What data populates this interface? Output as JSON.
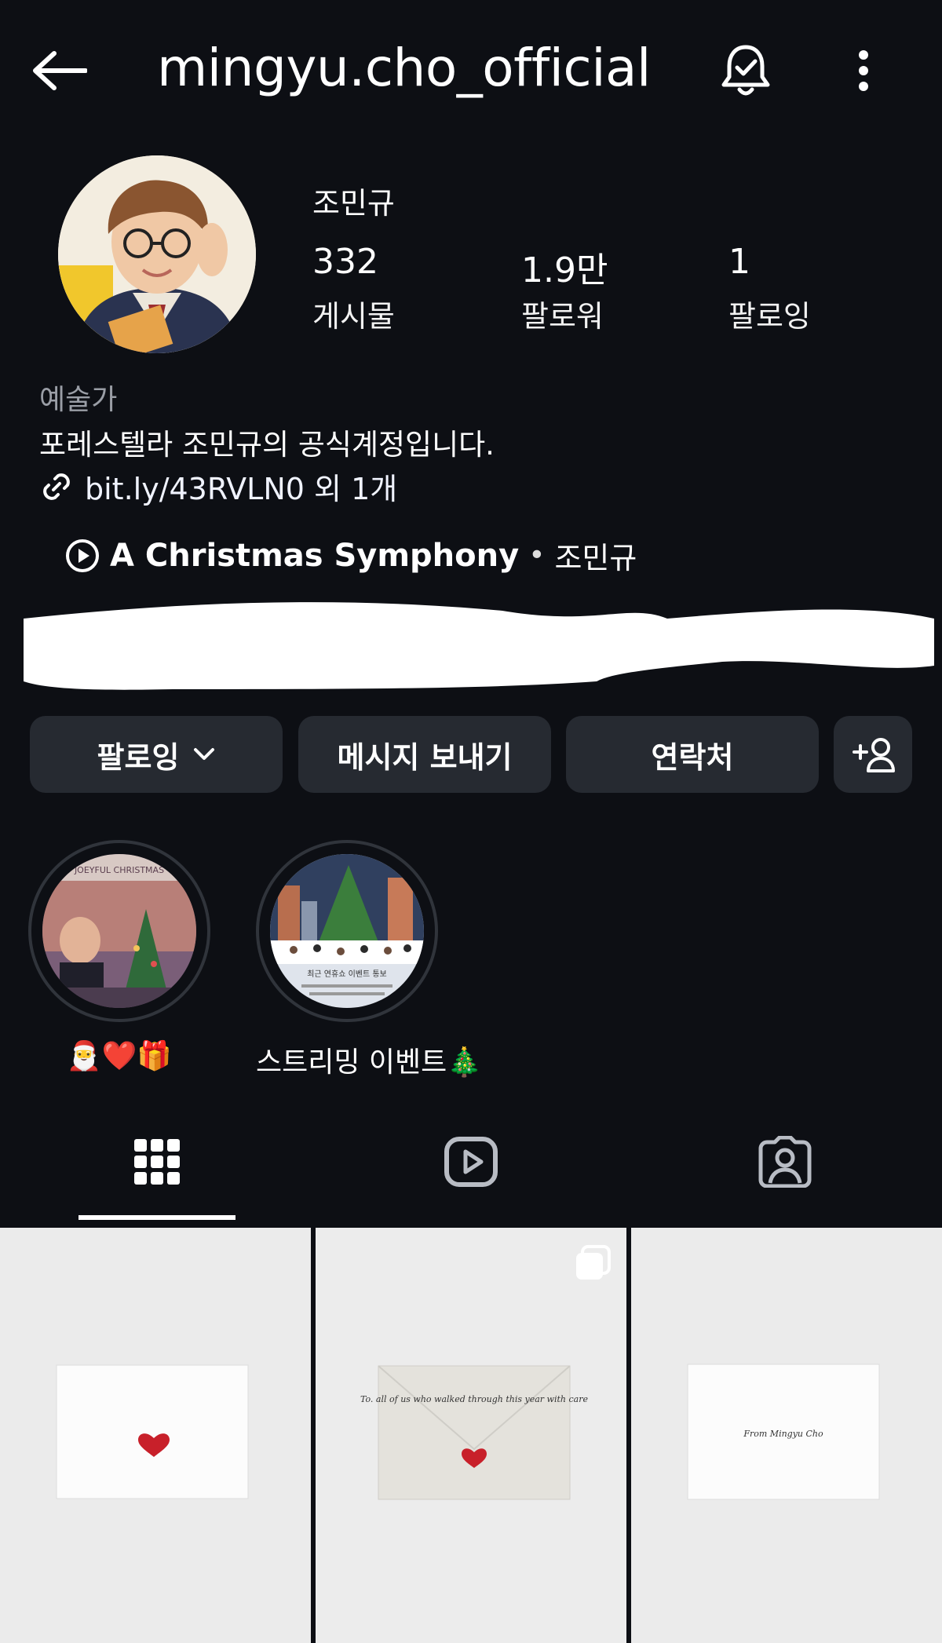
{
  "header": {
    "username": "mingyu.cho_official"
  },
  "profile": {
    "display_name": "조민규",
    "stats": [
      {
        "value": "332",
        "label": "게시물"
      },
      {
        "value": "1.9만",
        "label": "팔로워"
      },
      {
        "value": "1",
        "label": "팔로잉"
      }
    ],
    "category": "예술가",
    "bio": "포레스텔라 조민규의 공식계정입니다.",
    "link": "bit.ly/43RVLN0 외 1개",
    "music": {
      "title": "A Christmas Symphony",
      "separator": "•",
      "artist": "조민규"
    }
  },
  "actions": {
    "follow_label": "팔로잉",
    "message_label": "메시지 보내기",
    "contact_label": "연락처"
  },
  "highlights": [
    {
      "label": "🎅❤️🎁"
    },
    {
      "label": "스트리밍 이벤트🎄"
    }
  ],
  "highlight_art": {
    "hl1_caption": "JOEYFUL CHRISTMAS",
    "hl2_caption": "최근 연휴쇼 이벤트 통보"
  },
  "posts": [
    {
      "card_text": ""
    },
    {
      "card_text": "To. all of us who walked through this year with care"
    },
    {
      "card_text": "From Mingyu Cho"
    }
  ],
  "colors": {
    "background": "#0d0f14",
    "button_bg": "#262a31",
    "muted_text": "#9a9ea6"
  }
}
